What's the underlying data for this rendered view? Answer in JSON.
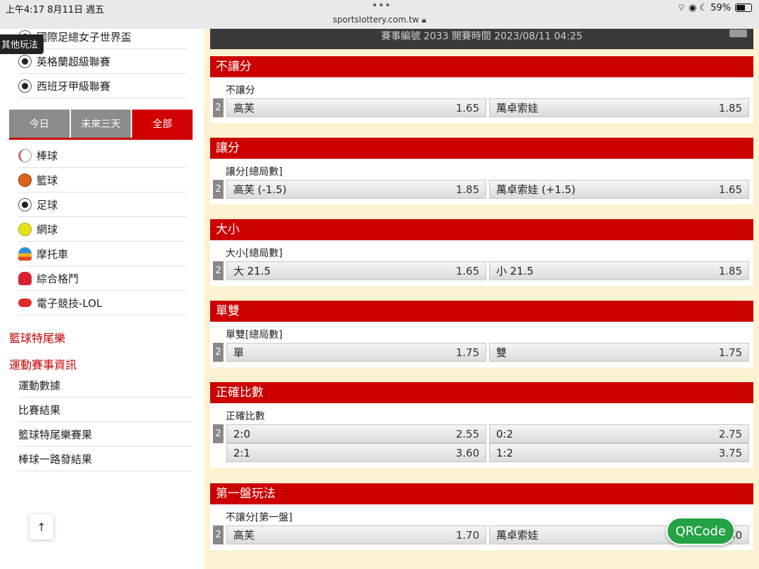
{
  "status": {
    "time_date": "上午4:17   8月11日 週五",
    "dots": "•••",
    "url": "sportslottery.com.tw",
    "indicators": "⌔ ◉ ☾ 59%"
  },
  "sidebar": {
    "tooltip": "其他玩法",
    "leagues": [
      {
        "label": "國際足總女子世界盃",
        "icon": "soccer-ball-icon"
      },
      {
        "label": "英格蘭超級聯賽",
        "icon": "soccer-ball-icon"
      },
      {
        "label": "西班牙甲級聯賽",
        "icon": "soccer-ball-icon"
      }
    ],
    "tabs": [
      {
        "label": "今日"
      },
      {
        "label": "未來三天"
      },
      {
        "label": "全部"
      }
    ],
    "sports": [
      {
        "label": "棒球",
        "icon": "baseball-icon"
      },
      {
        "label": "籃球",
        "icon": "basketball-icon"
      },
      {
        "label": "足球",
        "icon": "soccer-ball-icon"
      },
      {
        "label": "網球",
        "icon": "tennis-ball-icon"
      },
      {
        "label": "摩托車",
        "icon": "motorcycle-helmet-icon"
      },
      {
        "label": "綜合格鬥",
        "icon": "boxing-glove-icon"
      },
      {
        "label": "電子競技-LOL",
        "icon": "gamepad-icon"
      }
    ],
    "red_links": [
      "籃球特尾樂",
      "運動賽事資訊"
    ],
    "info_items": [
      "運動數據",
      "比賽結果",
      "籃球特尾樂賽果",
      "棒球一路發結果"
    ],
    "up_arrow": "↑"
  },
  "main": {
    "event_info": "賽事編號 2033 開賽時間 2023/08/11 04:25",
    "sections": [
      {
        "header": "不讓分",
        "subtitle": "不讓分",
        "rows": [
          {
            "badge": "2",
            "options": [
              {
                "label": "高芙",
                "odds": "1.65"
              },
              {
                "label": "萬卓索娃",
                "odds": "1.85"
              }
            ]
          }
        ]
      },
      {
        "header": "讓分",
        "subtitle": "讓分[總局數]",
        "rows": [
          {
            "badge": "2",
            "options": [
              {
                "label": "高芙 (-1.5)",
                "odds": "1.85"
              },
              {
                "label": "萬卓索娃 (+1.5)",
                "odds": "1.65"
              }
            ]
          }
        ]
      },
      {
        "header": "大小",
        "subtitle": "大小[總局數]",
        "rows": [
          {
            "badge": "2",
            "options": [
              {
                "label": "大 21.5",
                "odds": "1.65"
              },
              {
                "label": "小 21.5",
                "odds": "1.85"
              }
            ]
          }
        ]
      },
      {
        "header": "單雙",
        "subtitle": "單雙[總局數]",
        "rows": [
          {
            "badge": "2",
            "options": [
              {
                "label": "單",
                "odds": "1.75"
              },
              {
                "label": "雙",
                "odds": "1.75"
              }
            ]
          }
        ]
      },
      {
        "header": "正確比數",
        "subtitle": "正確比數",
        "rows": [
          {
            "badge": "2",
            "options": [
              {
                "label": "2:0",
                "odds": "2.55"
              },
              {
                "label": "0:2",
                "odds": "2.75"
              }
            ]
          },
          {
            "badge": "",
            "options": [
              {
                "label": "2:1",
                "odds": "3.60"
              },
              {
                "label": "1:2",
                "odds": "3.75"
              }
            ]
          }
        ]
      },
      {
        "header": "第一盤玩法",
        "subtitle": "不讓分[第一盤]",
        "rows": [
          {
            "badge": "2",
            "options": [
              {
                "label": "高芙",
                "odds": "1.70"
              },
              {
                "label": "萬卓索娃",
                "odds": "1.80"
              }
            ]
          }
        ]
      }
    ]
  },
  "qr_button": "QRCode",
  "colors": {
    "accent_red": "#cc0000",
    "tab_gray": "#8c8c8c",
    "main_bg": "#fbf2d2",
    "qr_green": "#25a244"
  }
}
